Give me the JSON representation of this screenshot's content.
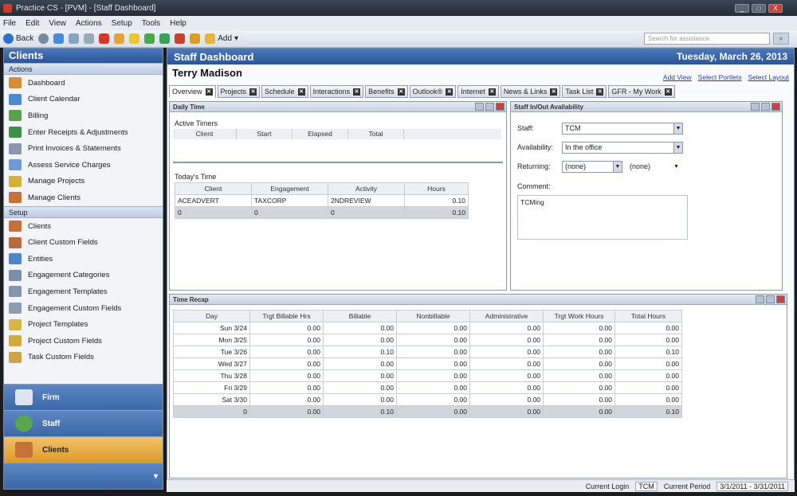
{
  "window": {
    "title": "Practice CS - [PVM] - [Staff Dashboard]",
    "min": "_",
    "max": "□",
    "close": "X"
  },
  "menu": [
    "File",
    "Edit",
    "View",
    "Actions",
    "Setup",
    "Tools",
    "Help"
  ],
  "toolbar": {
    "back": "Back",
    "add": "Add",
    "search_placeholder": "Search for assistance"
  },
  "left": {
    "header": "Clients",
    "actions_title": "Actions",
    "actions": [
      "Dashboard",
      "Client Calendar",
      "Billing",
      "Enter Receipts & Adjustments",
      "Print Invoices & Statements",
      "Assess Service Charges",
      "Manage Projects",
      "Manage Clients"
    ],
    "setup_title": "Setup",
    "setup": [
      "Clients",
      "Client Custom Fields",
      "Entities",
      "Engagement Categories",
      "Engagement Templates",
      "Engagement Custom Fields",
      "Project Templates",
      "Project Custom Fields",
      "Task Custom Fields"
    ],
    "buttons": [
      "Firm",
      "Staff",
      "Clients"
    ]
  },
  "main": {
    "title": "Staff Dashboard",
    "date": "Tuesday, March 26, 2013",
    "staff_name": "Terry Madison",
    "links": [
      "Add View",
      "Select Portlets",
      "Select Layout"
    ],
    "tabs": [
      "Overview",
      "Projects",
      "Schedule",
      "Interactions",
      "Benefits",
      "Outlook®",
      "Internet",
      "News & Links",
      "Task List",
      "GFR - My Work"
    ]
  },
  "daily_time": {
    "title": "Daily Time",
    "active_timers_label": "Active Timers",
    "timer_columns": [
      "Client",
      "Start",
      "Elapsed",
      "Total"
    ],
    "todays_time_label": "Today's Time",
    "columns": [
      "Client",
      "Engagement",
      "Activity",
      "Hours"
    ],
    "rows": [
      [
        "ACEADVERT",
        "TAXCORP",
        "2NDREVIEW",
        "0.10"
      ],
      [
        "0",
        "0",
        "0",
        "0.10"
      ]
    ]
  },
  "availability": {
    "title": "Staff In/Out Availability",
    "staff_label": "Staff:",
    "staff_value": "TCM",
    "availability_label": "Availability:",
    "availability_value": "In the office",
    "returning_label": "Returning:",
    "returning_date": "(none)",
    "returning_time": "(none)",
    "comment_label": "Comment:",
    "comment_value": "TCMing"
  },
  "time_recap": {
    "title": "Time Recap",
    "columns": [
      "Day",
      "Trgt Billable Hrs",
      "Billable",
      "Nonbillable",
      "Administrative",
      "Trgt Work Hours",
      "Total Hours"
    ],
    "rows": [
      [
        "Sun 3/24",
        "0.00",
        "0.00",
        "0.00",
        "0.00",
        "0.00",
        "0.00"
      ],
      [
        "Mon 3/25",
        "0.00",
        "0.00",
        "0.00",
        "0.00",
        "0.00",
        "0.00"
      ],
      [
        "Tue 3/26",
        "0.00",
        "0.10",
        "0.00",
        "0.00",
        "0.00",
        "0.10"
      ],
      [
        "Wed 3/27",
        "0.00",
        "0.00",
        "0.00",
        "0.00",
        "0.00",
        "0.00"
      ],
      [
        "Thu 3/28",
        "0.00",
        "0.00",
        "0.00",
        "0.00",
        "0.00",
        "0.00"
      ],
      [
        "Fri 3/29",
        "0.00",
        "0.00",
        "0.00",
        "0.00",
        "0.00",
        "0.00"
      ],
      [
        "Sat 3/30",
        "0.00",
        "0.00",
        "0.00",
        "0.00",
        "0.00",
        "0.00"
      ]
    ],
    "total": [
      "0",
      "0.00",
      "0.10",
      "0.00",
      "0.00",
      "0.00",
      "0.10"
    ]
  },
  "status": {
    "login_label": "Current Login",
    "login_value": "TCM",
    "period_label": "Current Period",
    "period_value": "3/1/2011 - 3/31/2011"
  }
}
